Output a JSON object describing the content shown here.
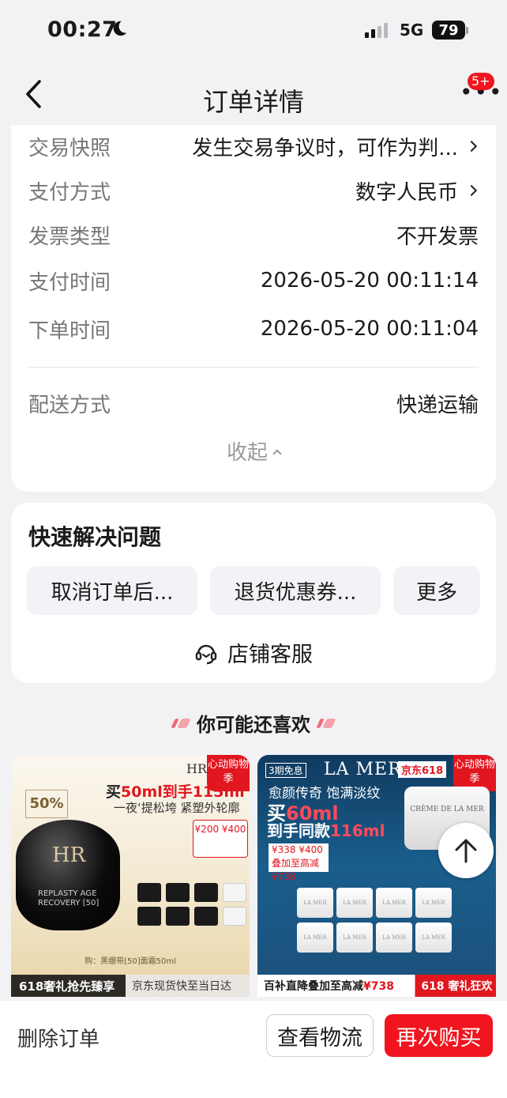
{
  "status": {
    "time": "00:27",
    "network": "5G",
    "battery": "79"
  },
  "nav": {
    "title": "订单详情",
    "badge": "5+"
  },
  "details": [
    {
      "label": "交易快照",
      "value": "发生交易争议时，可作为判..."
    },
    {
      "label": "支付方式",
      "value": "数字人民币"
    },
    {
      "label": "发票类型",
      "value": "不开发票"
    },
    {
      "label": "支付时间",
      "value": "2026-05-20 00:11:14"
    },
    {
      "label": "下单时间",
      "value": "2026-05-20 00:11:04"
    },
    {
      "label": "配送方式",
      "value": "快递运输"
    }
  ],
  "collapse_label": "收起",
  "quick": {
    "title": "快速解决问题",
    "chips": [
      "取消订单后...",
      "退货优惠券...",
      "更多"
    ],
    "service": "店铺客服"
  },
  "recommend": {
    "title": "你可能还喜欢",
    "products": [
      {
        "brand": "HR",
        "tag": "心动购物季",
        "headline_pre": "买",
        "headline_a": "50ml到手",
        "headline_b": "115ml",
        "subline": "一夜‘提松垮 紧塑外轮廓",
        "percent": "50%",
        "jar_logo": "HR",
        "jar_text": "REPLASTY AGE RECOVERY [50]",
        "price_box": "¥200 ¥400",
        "caption": "购：黑绷带[50]面霜50ml",
        "strip_left": "618奢礼抢先臻享",
        "strip_right": "京东现货快至当日达"
      },
      {
        "brand": "LA MER",
        "free_tag": "3期免息",
        "jd_tag": "京东618",
        "tag": "心动购物季",
        "line1": "愈颜传奇 饱满淡纹",
        "line2_pre": "买",
        "line2_red": "60ml",
        "line3_pre": "到手同款",
        "line3_red": "116ml",
        "jar_text": "CRÈME DE LA MER",
        "price_box": "¥338 ¥400 叠加至高减¥738",
        "mini_label": "LA MER",
        "strip_left_pre": "百补直降叠加至高减",
        "strip_left_red": "¥738",
        "strip_right": "618 奢礼狂欢"
      }
    ]
  },
  "bottom": {
    "delete": "删除订单",
    "logistics": "查看物流",
    "rebuy": "再次购买"
  },
  "colors": {
    "accent": "#f0151f",
    "background": "#f2f2f4"
  }
}
